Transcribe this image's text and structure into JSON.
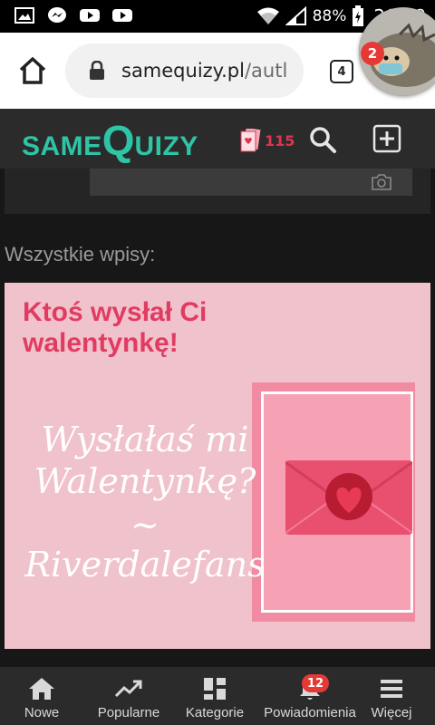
{
  "status_bar": {
    "battery": "88%",
    "time": "20:18"
  },
  "browser": {
    "url_host": "samequizy.pl",
    "url_path": "/autl",
    "tab_count": "4",
    "notification_count": "2"
  },
  "site": {
    "logo_left": "SAME",
    "logo_q": "Q",
    "logo_right": "UIZY",
    "cards_count": "115"
  },
  "feed": {
    "section_title": "Wszystkie wpisy:",
    "card": {
      "title": "Ktoś wysłał Ci walentynkę!",
      "line1": "Wysłałaś mi",
      "line2": "Walentynkę?",
      "line3": "~",
      "line4": "Riverdalefans"
    }
  },
  "bottom_nav": {
    "items": [
      {
        "label": "Nowe",
        "icon": "home-icon"
      },
      {
        "label": "Popularne",
        "icon": "trending-icon"
      },
      {
        "label": "Kategorie",
        "icon": "grid-icon"
      },
      {
        "label": "Powiadomienia",
        "icon": "bell-icon",
        "badge": "12"
      },
      {
        "label": "Więcej",
        "icon": "menu-icon"
      }
    ]
  },
  "colors": {
    "accent": "#2ec4a6",
    "brand_red": "#e23b62",
    "card_bg": "#f0c2cc"
  }
}
